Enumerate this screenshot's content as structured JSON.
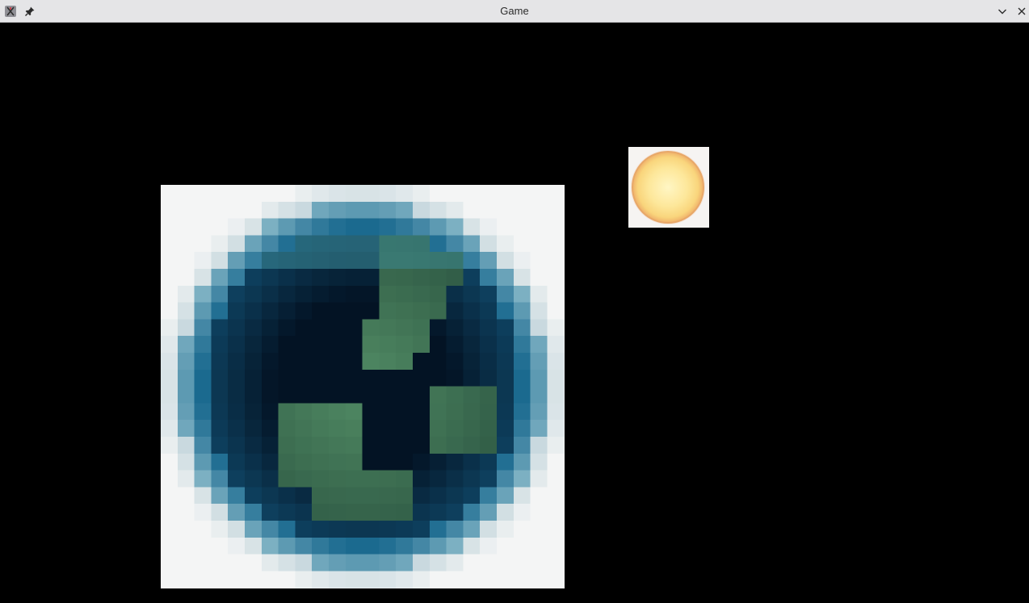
{
  "window": {
    "title": "Game",
    "icons": {
      "app": "app-icon",
      "pin": "pin-icon",
      "minimize": "chevron-down-icon",
      "close": "close-icon"
    }
  },
  "scene": {
    "background": "#000000",
    "sprites": [
      {
        "name": "earth-sprite",
        "kind": "planet"
      },
      {
        "name": "sun-sprite",
        "kind": "star"
      }
    ]
  },
  "colors": {
    "titlebar": "#e5e5e7",
    "ocean_deep": "#031324",
    "ocean_edge": "#1b6a8f",
    "land": "#3f6b4f",
    "sun_core": "#fde79a",
    "sun_rim": "#efb06a"
  }
}
